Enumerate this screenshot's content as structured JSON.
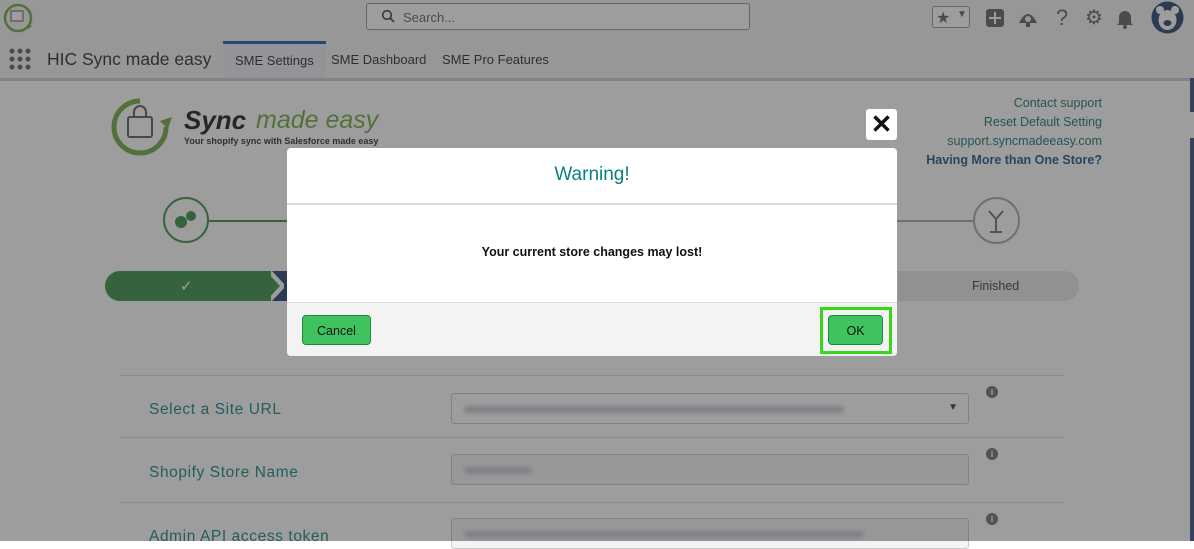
{
  "header": {
    "search_placeholder": "Search...",
    "icons": [
      "favorites-star-icon",
      "add-icon",
      "setup-assistant-icon",
      "help-icon",
      "gear-icon",
      "notifications-bell-icon",
      "user-avatar-icon"
    ]
  },
  "app": {
    "name": "HIC Sync made easy",
    "tabs": [
      {
        "label": "SME Settings",
        "active": true
      },
      {
        "label": "SME Dashboard",
        "active": false
      },
      {
        "label": "SME Pro Features",
        "active": false
      }
    ]
  },
  "logo": {
    "title_bold": "Sync",
    "title_rest": "made easy",
    "tagline": "Your shopify sync with Salesforce made easy"
  },
  "links": {
    "contact": "Contact support",
    "reset": "Reset Default Setting",
    "site": "support.syncmadeeasy.com",
    "more_store": "Having More than One Store?"
  },
  "progress": {
    "step_done_mark": "✓",
    "finished_label": "Finished"
  },
  "form": {
    "site_url_label": "Select a Site URL",
    "store_name_label": "Shopify Store Name",
    "token_label": "Admin API access token"
  },
  "modal": {
    "title": "Warning!",
    "message": "Your current store changes may lost!",
    "cancel_label": "Cancel",
    "ok_label": "OK",
    "close_glyph": "✕"
  },
  "colors": {
    "accent_teal": "#0b7f7f",
    "button_green": "#3fc35f",
    "highlight_green": "#39d61d",
    "progress_green": "#2e8b3e",
    "progress_navy": "#1b3a6b"
  }
}
